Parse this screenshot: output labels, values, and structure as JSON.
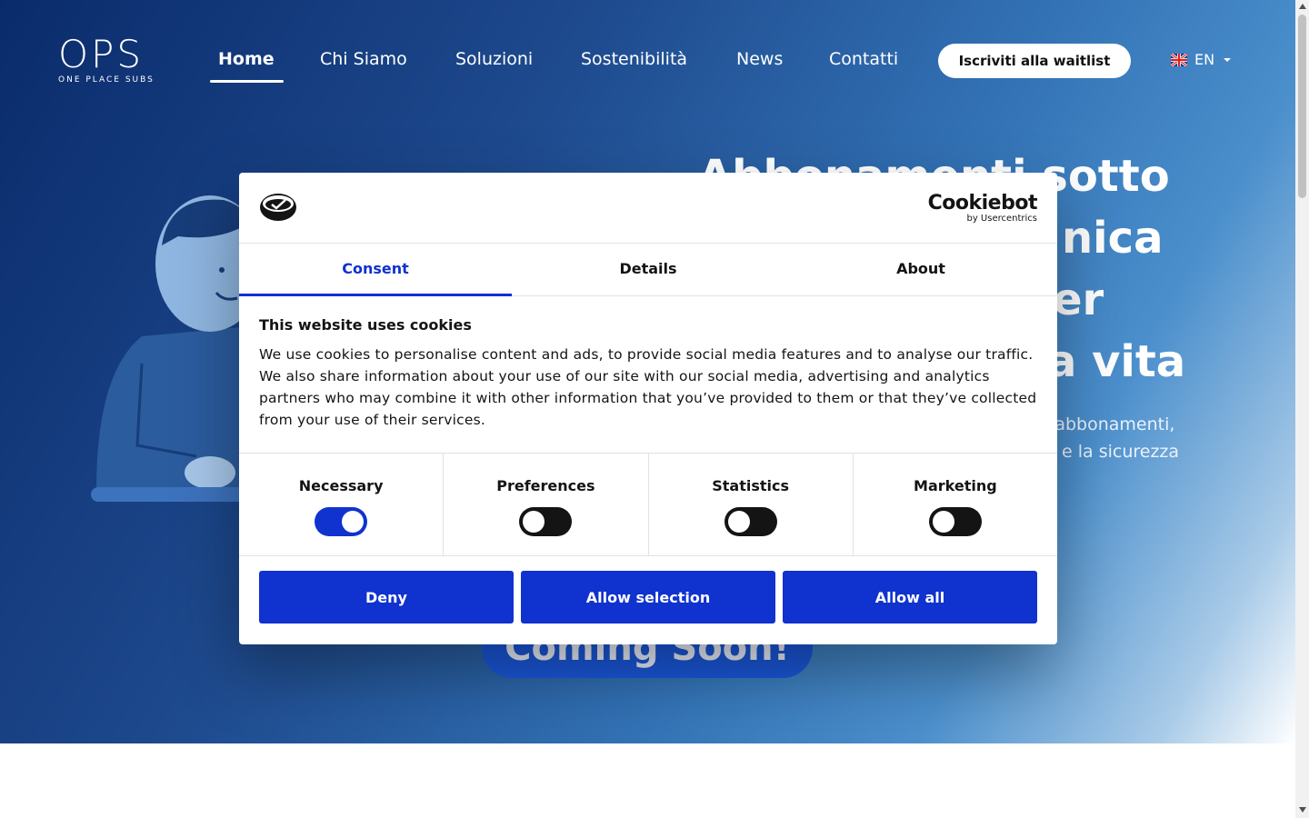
{
  "nav": {
    "logo_text": "OPS",
    "logo_sub": "ONE PLACE SUBS",
    "items": [
      {
        "label": "Home",
        "active": true
      },
      {
        "label": "Chi Siamo"
      },
      {
        "label": "Soluzioni"
      },
      {
        "label": "Sostenibilità"
      },
      {
        "label": "News"
      },
      {
        "label": "Contatti"
      }
    ],
    "waitlist_label": "Iscriviti alla waitlist",
    "language": "EN"
  },
  "hero": {
    "title_lines": [
      "Abbonamenti sotto",
      "nica",
      "er",
      "a vita"
    ],
    "subtitle_lines": [
      "i abbonamenti,",
      "e la sicurezza"
    ],
    "cta_label": "Coming Soon!"
  },
  "cookie_dialog": {
    "brand_main": "Cookiebot",
    "brand_sub": "by Usercentrics",
    "tabs": [
      {
        "label": "Consent",
        "active": true
      },
      {
        "label": "Details"
      },
      {
        "label": "About"
      }
    ],
    "title": "This website uses cookies",
    "body": "We use cookies to personalise content and ads, to provide social media features and to analyse our traffic. We also share information about your use of our site with our social media, advertising and analytics partners who may combine it with other information that you’ve provided to them or that they’ve collected from your use of their services.",
    "switches": [
      {
        "label": "Necessary",
        "checked": true
      },
      {
        "label": "Preferences",
        "checked": false
      },
      {
        "label": "Statistics",
        "checked": false
      },
      {
        "label": "Marketing",
        "checked": false
      }
    ],
    "buttons": {
      "deny": "Deny",
      "allow_selection": "Allow selection",
      "allow_all": "Allow all"
    }
  },
  "colors": {
    "primary_blue": "#1032cf",
    "hero_dark": "#0a2b6b",
    "cta_blue": "#1a57d9"
  }
}
